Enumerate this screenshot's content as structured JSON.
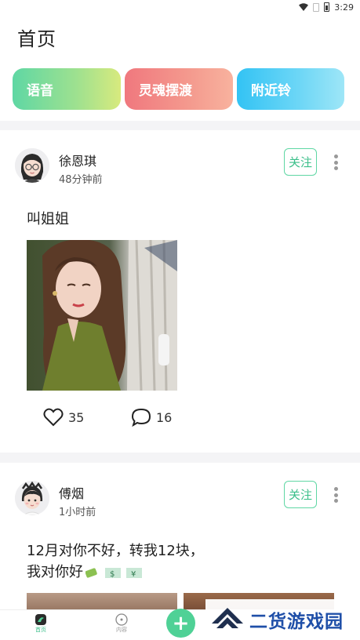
{
  "status_bar": {
    "time": "3:29"
  },
  "header": {
    "title": "首页",
    "chips": [
      {
        "label": "语音"
      },
      {
        "label": "灵魂摆渡"
      },
      {
        "label": "附近铃"
      }
    ]
  },
  "posts": [
    {
      "username": "徐恩琪",
      "time": "48分钟前",
      "follow_label": "关注",
      "text": "叫姐姐",
      "likes": "35",
      "comments": "16"
    },
    {
      "username": "傅烟",
      "time": "1小时前",
      "follow_label": "关注",
      "text_line1": "12月对你不好，转我12块，",
      "text_line2": "我对你好"
    }
  ],
  "bottom_nav": {
    "home_label": "首页",
    "content_label": "内容",
    "add_label": "+"
  },
  "watermark": {
    "text": "二货游戏园"
  },
  "colors": {
    "accent": "#4fd196",
    "follow": "#3bbf8a"
  }
}
